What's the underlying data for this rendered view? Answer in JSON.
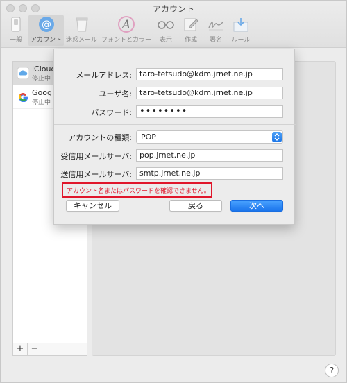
{
  "window": {
    "title": "アカウント"
  },
  "toolbar": {
    "items": [
      {
        "label": "一般",
        "icon": "switch-icon"
      },
      {
        "label": "アカウント",
        "icon": "at-icon",
        "active": true
      },
      {
        "label": "迷惑メール",
        "icon": "trash-icon"
      },
      {
        "label": "フォントとカラー",
        "icon": "font-color-icon"
      },
      {
        "label": "表示",
        "icon": "glasses-icon"
      },
      {
        "label": "作成",
        "icon": "compose-icon"
      },
      {
        "label": "署名",
        "icon": "signature-icon"
      },
      {
        "label": "ルール",
        "icon": "rules-icon"
      }
    ]
  },
  "accounts": [
    {
      "name": "iCloud",
      "status": "停止中",
      "icon": "icloud-icon"
    },
    {
      "name": "Google",
      "status": "停止中",
      "icon": "google-icon"
    }
  ],
  "list_footer": {
    "add": "+",
    "remove": "−"
  },
  "help": {
    "label": "?"
  },
  "sheet": {
    "email": {
      "label": "メールアドレス:",
      "value": "taro-tetsudo@kdm.jrnet.ne.jp"
    },
    "username": {
      "label": "ユーザ名:",
      "value": "taro-tetsudo@kdm.jrnet.ne.jp"
    },
    "password": {
      "label": "パスワード:",
      "value": "••••••••"
    },
    "account_type": {
      "label": "アカウントの種類:",
      "value": "POP"
    },
    "incoming": {
      "label": "受信用メールサーバ:",
      "value": "pop.jrnet.ne.jp"
    },
    "outgoing": {
      "label": "送信用メールサーバ:",
      "value": "smtp.jrnet.ne.jp"
    },
    "error": "アカウント名またはパスワードを確認できません。",
    "buttons": {
      "cancel": "キャンセル",
      "back": "戻る",
      "next": "次へ"
    }
  },
  "colors": {
    "error": "#e0162b",
    "accent": "#1a74ec"
  }
}
